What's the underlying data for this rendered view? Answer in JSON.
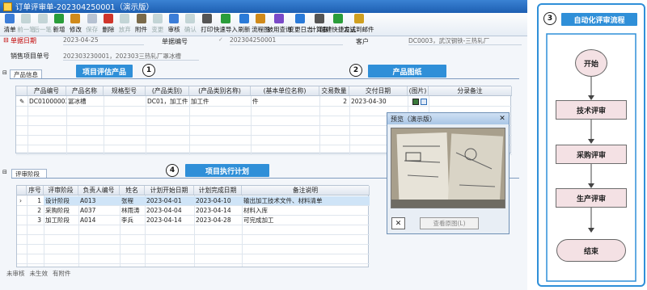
{
  "window": {
    "title": "订单评审单-202304250001（演示版）"
  },
  "toolbar": {
    "items": [
      {
        "label": "清单",
        "icon": "list-icon",
        "color": "#3b7dd8",
        "enabled": true
      },
      {
        "label": "前一笔",
        "icon": "arrow-up-icon",
        "color": "#8aa",
        "enabled": false
      },
      {
        "label": "后一笔",
        "icon": "arrow-down-icon",
        "color": "#8aa",
        "enabled": false
      },
      {
        "label": "新增",
        "icon": "new-doc-icon",
        "color": "#2a9d3a",
        "enabled": true
      },
      {
        "label": "修改",
        "icon": "edit-icon",
        "color": "#d08a1a",
        "enabled": true
      },
      {
        "label": "保存",
        "icon": "save-icon",
        "color": "#6a7fa0",
        "enabled": false
      },
      {
        "label": "删除",
        "icon": "delete-icon",
        "color": "#d0352b",
        "enabled": true
      },
      {
        "label": "放弃",
        "icon": "undo-icon",
        "color": "#8aa",
        "enabled": false
      },
      {
        "label": "附件",
        "icon": "attachment-icon",
        "color": "#7a6a4a",
        "enabled": true
      },
      {
        "label": "变更",
        "icon": "change-icon",
        "color": "#8aa",
        "enabled": false
      },
      {
        "label": "审核",
        "icon": "approve-icon",
        "color": "#3b7dd8",
        "enabled": true
      },
      {
        "label": "确认",
        "icon": "confirm-icon",
        "color": "#8aa",
        "enabled": false
      },
      {
        "label": "打印",
        "icon": "print-icon",
        "color": "#555",
        "enabled": true
      },
      {
        "label": "快速导入",
        "icon": "import-icon",
        "color": "#2a9d3a",
        "enabled": true
      },
      {
        "label": "刷新",
        "icon": "refresh-icon",
        "color": "#2a7ad8",
        "enabled": true
      },
      {
        "label": "流程图",
        "icon": "flowchart-icon",
        "color": "#d08a1a",
        "enabled": true
      },
      {
        "label": "被用查询",
        "icon": "query-icon",
        "color": "#7a4ac8",
        "enabled": true
      },
      {
        "label": "变更日志",
        "icon": "log-icon",
        "color": "#2a7ad8",
        "enabled": true
      },
      {
        "label": "计算器",
        "icon": "calculator-icon",
        "color": "#555",
        "enabled": true
      },
      {
        "label": "创建快捷方式",
        "icon": "shortcut-icon",
        "color": "#2a9d3a",
        "enabled": true
      },
      {
        "label": "发送到邮件",
        "icon": "mail-icon",
        "color": "#d0a020",
        "enabled": true
      }
    ]
  },
  "form": {
    "date_label": "单据日期",
    "date_value": "2023-04-25",
    "number_label": "单据编号",
    "number_value": "202304250001",
    "customer_label": "客户",
    "customer_value": "DC0003，武汉钢铁-三热轧厂",
    "sales_item_label": "销售项目单号",
    "sales_item_value": "202303230001，202303三热轧厂罩冰槽"
  },
  "product_section": {
    "tab_label": "产品信息",
    "callout": "项目评估产品",
    "callout_num": "1",
    "drawing_callout": "产品图纸",
    "drawing_num": "2",
    "columns": [
      "产品编号",
      "产品名称",
      "规格型号",
      "(产品类别)",
      "(产品类别名称)",
      "(基本单位名称)",
      "交易数量",
      "交付日期",
      "(图片)",
      "分录备注"
    ],
    "rows": [
      {
        "code": "DC01000003",
        "name": "冨冰槽",
        "spec": "",
        "cat": "DC01，加工件",
        "cat_name": "加工件",
        "unit": "件",
        "qty": "2",
        "date": "2023-04-30",
        "remark": ""
      }
    ]
  },
  "preview": {
    "title": "预览（演示版）",
    "save_button": "查看原图(L)"
  },
  "review_section": {
    "tab_label": "评审阶段",
    "callout": "项目执行计划",
    "callout_num": "4",
    "columns": [
      "序号",
      "评审阶段",
      "负责人编号",
      "姓名",
      "计划开始日期",
      "计划完成日期",
      "备注说明"
    ],
    "rows": [
      {
        "seq": "1",
        "stage": "设计阶段",
        "owner_code": "A013",
        "name": "张程",
        "start": "2023-04-01",
        "end": "2023-04-10",
        "note": "输出加工技术文件、材料清单"
      },
      {
        "seq": "2",
        "stage": "采购阶段",
        "owner_code": "A037",
        "name": "林雨涛",
        "start": "2023-04-04",
        "end": "2023-04-14",
        "note": "材料入库"
      },
      {
        "seq": "3",
        "stage": "加工阶段",
        "owner_code": "A014",
        "name": "李兵",
        "start": "2023-04-14",
        "end": "2023-04-28",
        "note": "可完成加工"
      }
    ]
  },
  "status": {
    "items": [
      "未审核",
      "未生效",
      "有附件"
    ]
  },
  "flow": {
    "num": "3",
    "title": "自动化评审流程",
    "start": "开始",
    "steps": [
      "技术评审",
      "采购评审",
      "生产评审"
    ],
    "end": "结束"
  }
}
